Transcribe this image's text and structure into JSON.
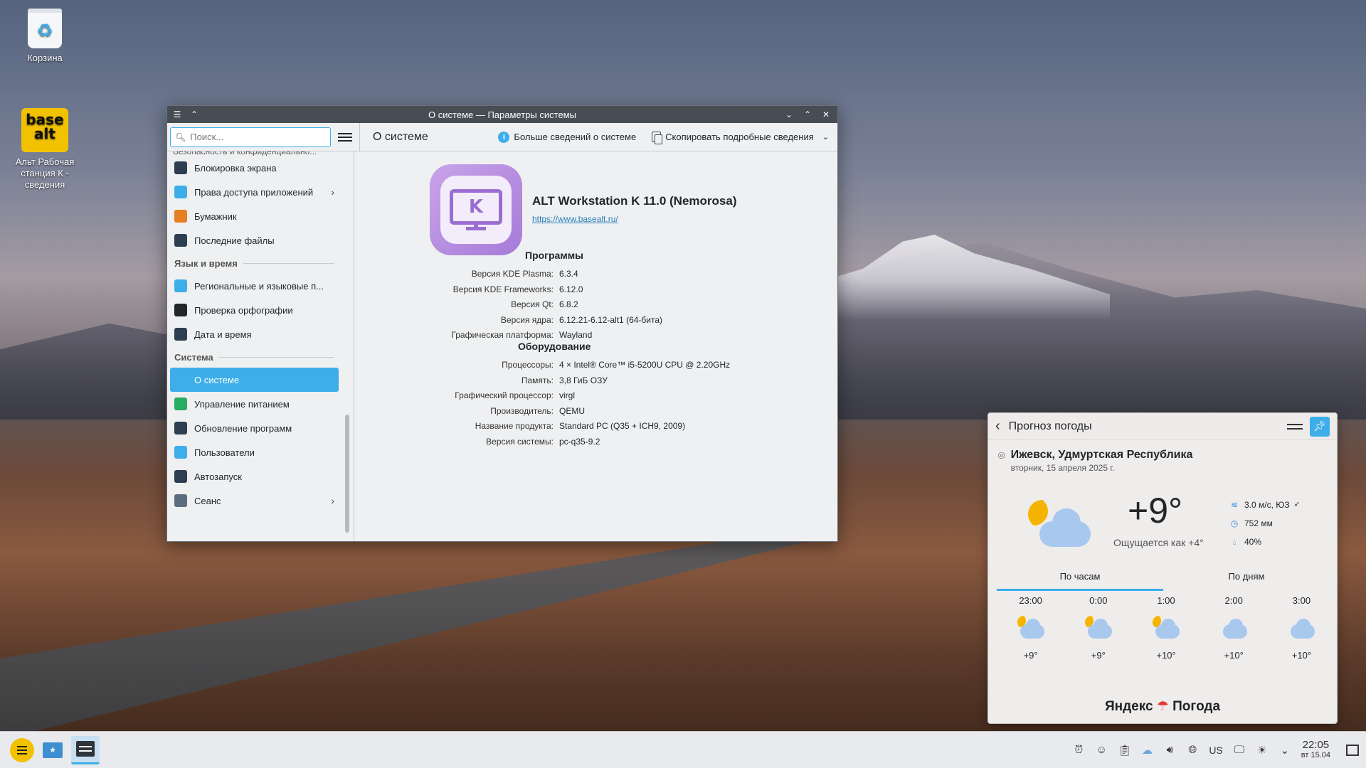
{
  "desktop": {
    "icons": [
      {
        "label": "Корзина"
      },
      {
        "label": "Альт Рабочая станция К - сведения",
        "logo_text": "base alt"
      }
    ]
  },
  "window": {
    "title": "О системе — Параметры системы",
    "search_placeholder": "Поиск...",
    "page_title": "О системе",
    "action_more": "Больше сведений о системе",
    "action_copy": "Скопировать подробные сведения",
    "sidebar": {
      "cut_category": "Безопасность и конфиденциально...",
      "items_security": [
        {
          "label": "Блокировка экрана",
          "icon": "lock-screen-icon",
          "color": "#2c3e50"
        },
        {
          "label": "Права доступа приложений",
          "icon": "shield-icon",
          "color": "#3daee9",
          "chevron": true
        },
        {
          "label": "Бумажник",
          "icon": "wallet-icon",
          "color": "#e67e22"
        },
        {
          "label": "Последние файлы",
          "icon": "clock-icon",
          "color": "#2c3e50"
        }
      ],
      "cat_lang": "Язык и время",
      "items_lang": [
        {
          "label": "Региональные и языковые п...",
          "icon": "flag-icon",
          "color": "#3daee9"
        },
        {
          "label": "Проверка орфографии",
          "icon": "spellcheck-icon",
          "color": "#232629"
        },
        {
          "label": "Дата и время",
          "icon": "clock-icon",
          "color": "#2c3e50"
        }
      ],
      "cat_system": "Система",
      "items_system": [
        {
          "label": "О системе",
          "icon": "info-icon",
          "color": "#3daee9",
          "active": true
        },
        {
          "label": "Управление питанием",
          "icon": "power-icon",
          "color": "#27ae60"
        },
        {
          "label": "Обновление программ",
          "icon": "update-icon",
          "color": "#2c3e50"
        },
        {
          "label": "Пользователи",
          "icon": "users-icon",
          "color": "#3daee9"
        },
        {
          "label": "Автозапуск",
          "icon": "autostart-icon",
          "color": "#2c3e50"
        },
        {
          "label": "Сеанс",
          "icon": "session-icon",
          "color": "#5d6d7e",
          "chevron": true
        }
      ]
    },
    "content": {
      "logo_letter": "K",
      "os_name": "ALT Workstation K 11.0 (Nemorosa)",
      "os_url": "https://www.basealt.ru/",
      "software_title": "Программы",
      "software": [
        {
          "k": "Версия KDE Plasma:",
          "v": "6.3.4"
        },
        {
          "k": "Версия KDE Frameworks:",
          "v": "6.12.0"
        },
        {
          "k": "Версия Qt:",
          "v": "6.8.2"
        },
        {
          "k": "Версия ядра:",
          "v": "6.12.21-6.12-alt1 (64-бита)"
        },
        {
          "k": "Графическая платформа:",
          "v": "Wayland"
        }
      ],
      "hardware_title": "Оборудование",
      "hardware": [
        {
          "k": "Процессоры:",
          "v": "4 × Intel® Core™ i5-5200U CPU @ 2.20GHz"
        },
        {
          "k": "Память:",
          "v": "3,8 ГиБ ОЗУ"
        },
        {
          "k": "Графический процессор:",
          "v": "virgl"
        },
        {
          "k": "Производитель:",
          "v": "QEMU"
        },
        {
          "k": "Название продукта:",
          "v": "Standard PC (Q35 + ICH9, 2009)"
        },
        {
          "k": "Версия системы:",
          "v": "pc-q35-9.2"
        }
      ]
    }
  },
  "weather": {
    "title": "Прогноз погоды",
    "city": "Ижевск, Удмуртская Республика",
    "date": "вторник, 15 апреля 2025 г.",
    "temp": "+9°",
    "feels": "Ощущается как +4°",
    "wind": "3.0 м/с, ЮЗ",
    "pressure": "752 мм",
    "humidity": "40%",
    "tab_hourly": "По часам",
    "tab_daily": "По дням",
    "hours": [
      {
        "time": "23:00",
        "temp": "+9°",
        "moon": true
      },
      {
        "time": "0:00",
        "temp": "+9°",
        "moon": true
      },
      {
        "time": "1:00",
        "temp": "+10°",
        "moon": true
      },
      {
        "time": "2:00",
        "temp": "+10°",
        "moon": false
      },
      {
        "time": "3:00",
        "temp": "+10°",
        "moon": false
      }
    ],
    "brand_left": "Яндекс",
    "brand_right": "Погода"
  },
  "taskbar": {
    "keyboard_layout": "US",
    "time": "22:05",
    "date": "вт 15.04"
  }
}
